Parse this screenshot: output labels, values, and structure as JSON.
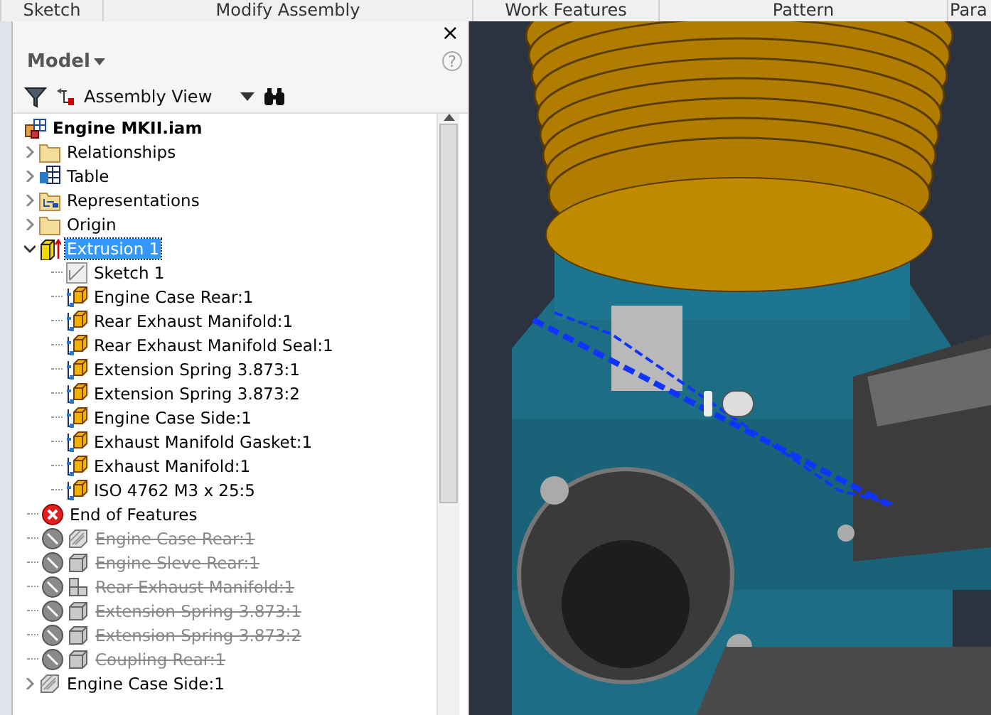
{
  "ribbon": {
    "panels": [
      {
        "label": "Sketch"
      },
      {
        "label": "Modify Assembly"
      },
      {
        "label": "Work Features"
      },
      {
        "label": "Pattern"
      },
      {
        "label": "Para"
      }
    ]
  },
  "browser": {
    "title": "Model",
    "close": "×",
    "help": "?",
    "view": "Assembly View",
    "tree": [
      {
        "label": "Engine MKII.iam",
        "kind": "assembly",
        "selected": false,
        "suppressed": false,
        "children": [
          {
            "label": "Relationships",
            "kind": "folder",
            "expanded": false,
            "selected": false,
            "suppressed": false
          },
          {
            "label": "Table",
            "kind": "table",
            "expanded": false,
            "selected": false,
            "suppressed": false
          },
          {
            "label": "Representations",
            "kind": "representations",
            "expanded": false,
            "selected": false,
            "suppressed": false
          },
          {
            "label": "Origin",
            "kind": "folder",
            "expanded": false,
            "selected": false,
            "suppressed": false
          },
          {
            "label": "Extrusion 1",
            "kind": "extrusion",
            "expanded": true,
            "selected": true,
            "suppressed": false,
            "children": [
              {
                "label": "Sketch 1",
                "kind": "sketch",
                "selected": false,
                "suppressed": false
              },
              {
                "label": "Engine Case Rear:1",
                "kind": "part",
                "selected": false,
                "suppressed": false
              },
              {
                "label": "Rear Exhaust Manifold:1",
                "kind": "part",
                "selected": false,
                "suppressed": false
              },
              {
                "label": "Rear Exhaust Manifold Seal:1",
                "kind": "part",
                "selected": false,
                "suppressed": false
              },
              {
                "label": "Extension Spring 3.873:1",
                "kind": "part",
                "selected": false,
                "suppressed": false
              },
              {
                "label": "Extension Spring 3.873:2",
                "kind": "part",
                "selected": false,
                "suppressed": false
              },
              {
                "label": "Engine Case Side:1",
                "kind": "part",
                "selected": false,
                "suppressed": false
              },
              {
                "label": "Exhaust Manifold Gasket:1",
                "kind": "part",
                "selected": false,
                "suppressed": false
              },
              {
                "label": "Exhaust Manifold:1",
                "kind": "part",
                "selected": false,
                "suppressed": false
              },
              {
                "label": "ISO 4762 M3 x 25:5",
                "kind": "part",
                "selected": false,
                "suppressed": false
              }
            ]
          },
          {
            "label": "End of Features",
            "kind": "end",
            "selected": false,
            "suppressed": false
          },
          {
            "label": "Engine Case Rear:1",
            "kind": "surface",
            "selected": false,
            "suppressed": true
          },
          {
            "label": "Engine Sleve Rear:1",
            "kind": "block",
            "selected": false,
            "suppressed": true
          },
          {
            "label": "Rear Exhaust Manifold:1",
            "kind": "subassembly",
            "selected": false,
            "suppressed": true
          },
          {
            "label": "Extension Spring 3.873:1",
            "kind": "block",
            "selected": false,
            "suppressed": true
          },
          {
            "label": "Extension Spring 3.873:2",
            "kind": "block",
            "selected": false,
            "suppressed": true
          },
          {
            "label": "Coupling Rear:1",
            "kind": "block",
            "selected": false,
            "suppressed": true
          },
          {
            "label": "Engine Case Side:1",
            "kind": "surface",
            "expanded": false,
            "selected": false,
            "suppressed": false
          }
        ]
      }
    ]
  }
}
